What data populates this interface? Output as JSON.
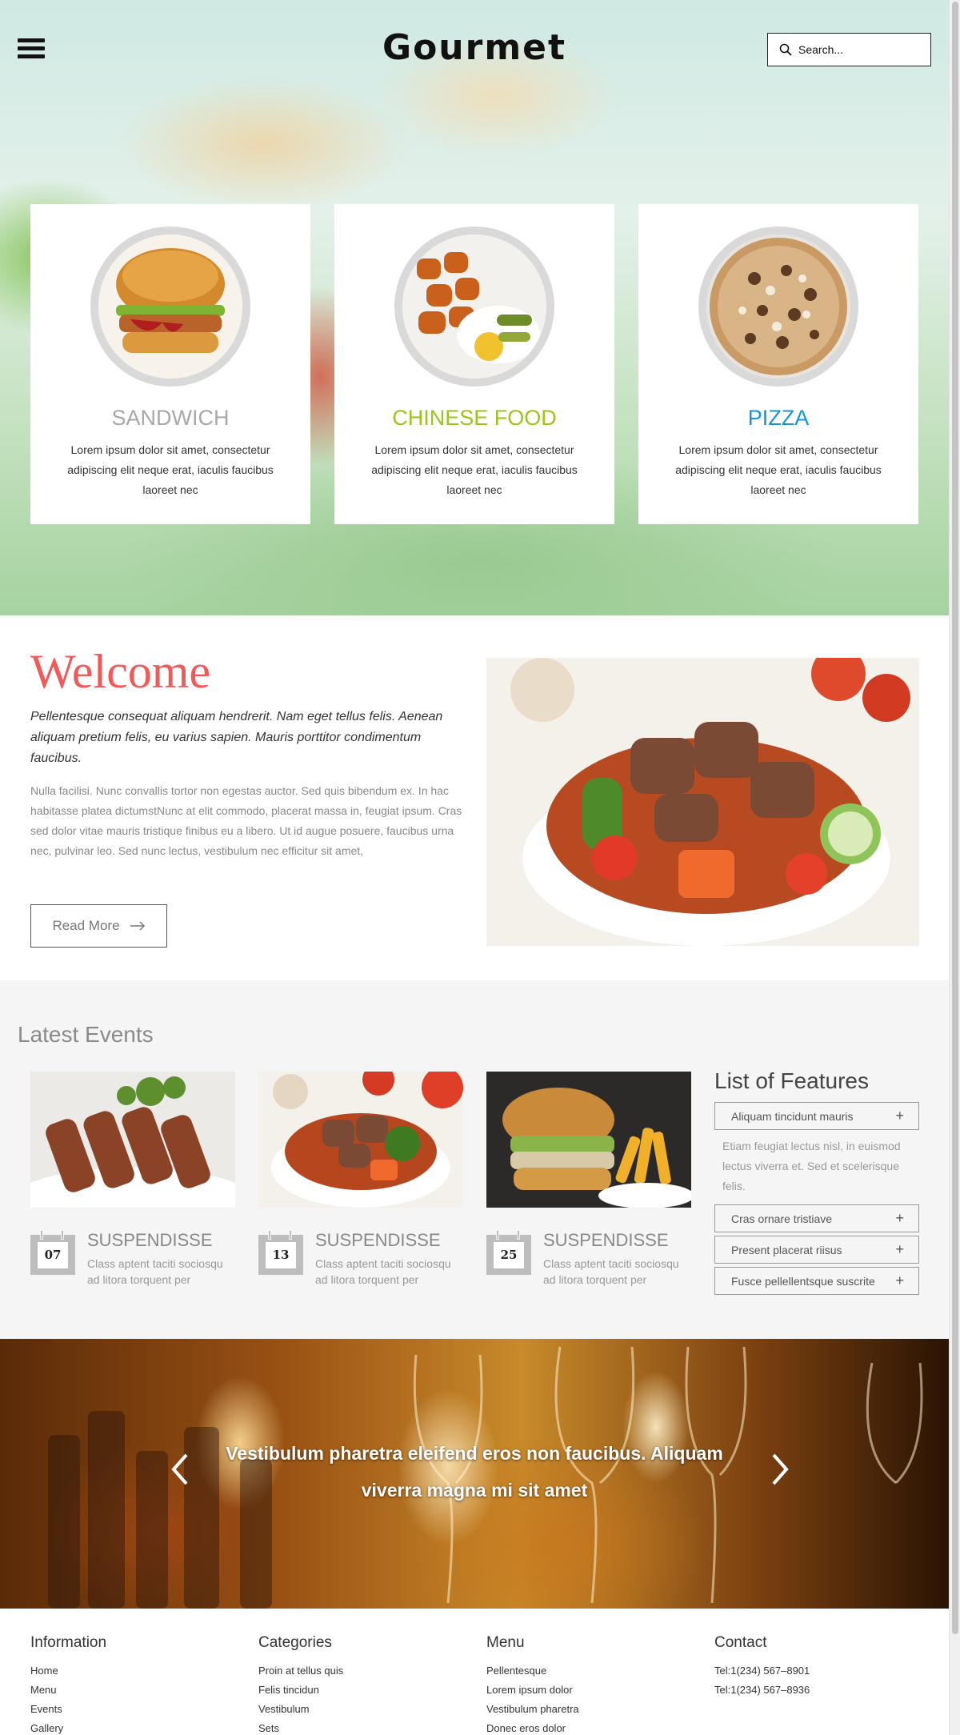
{
  "header": {
    "logo": "Gourmet",
    "search_placeholder": "Search..."
  },
  "cards": [
    {
      "title": "SANDWICH",
      "color": "#a8a8a8",
      "text": "Lorem ipsum dolor sit amet, consectetur adipiscing elit neque erat, iaculis faucibus laoreet nec"
    },
    {
      "title": "CHINESE FOOD",
      "color": "#9cc51b",
      "text": "Lorem ipsum dolor sit amet, consectetur adipiscing elit neque erat, iaculis faucibus laoreet nec"
    },
    {
      "title": "PIZZA",
      "color": "#1596d6",
      "text": "Lorem ipsum dolor sit amet, consectetur adipiscing elit neque erat, iaculis faucibus laoreet nec"
    }
  ],
  "welcome": {
    "title": "Welcome",
    "lead": "Pellentesque consequat aliquam hendrerit. Nam eget tellus felis. Aenean aliquam pretium felis, eu varius sapien. Mauris porttitor condimentum faucibus.",
    "body": "Nulla facilisi. Nunc convallis tortor non egestas auctor. Sed quis bibendum ex. In hac habitasse platea dictumstNunc at elit commodo, placerat massa in, feugiat ipsum. Cras sed dolor vitae mauris tristique finibus eu a libero. Ut id augue posuere, faucibus urna nec, pulvinar leo. Sed nunc lectus, vestibulum nec efficitur sit amet,",
    "button": "Read More"
  },
  "events": {
    "heading": "Latest Events",
    "items": [
      {
        "day": "07",
        "title": "SUSPENDISSE",
        "text": "Class aptent taciti sociosqu ad litora torquent per"
      },
      {
        "day": "13",
        "title": "SUSPENDISSE",
        "text": "Class aptent taciti sociosqu ad litora torquent per"
      },
      {
        "day": "25",
        "title": "SUSPENDISSE",
        "text": "Class aptent taciti sociosqu ad litora torquent per"
      }
    ]
  },
  "features": {
    "heading": "List of Features",
    "open_item": "Aliquam tincidunt mauris",
    "open_desc": "Etiam feugiat lectus nisl, in euismod lectus viverra et. Sed et scelerisque felis.",
    "items": [
      "Cras ornare tristiave",
      "Present placerat riisus",
      "Fusce pellellentsque suscrite"
    ]
  },
  "slider": {
    "caption": "Vestibulum pharetra eleifend eros non faucibus. Aliquam viverra magna mi sit amet"
  },
  "footer": {
    "columns": [
      {
        "heading": "Information",
        "links": [
          "Home",
          "Menu",
          "Events",
          "Gallery"
        ]
      },
      {
        "heading": "Categories",
        "links": [
          "Proin at tellus quis",
          "Felis tincidun",
          "Vestibulum",
          "Sets"
        ]
      },
      {
        "heading": "Menu",
        "links": [
          "Pellentesque",
          "Lorem ipsum dolor",
          "Vestibulum pharetra",
          "Donec eros dolor"
        ]
      },
      {
        "heading": "Contact",
        "links": [
          "Tel:1(234) 567–8901",
          "Tel:1(234) 567–8936"
        ]
      }
    ]
  }
}
